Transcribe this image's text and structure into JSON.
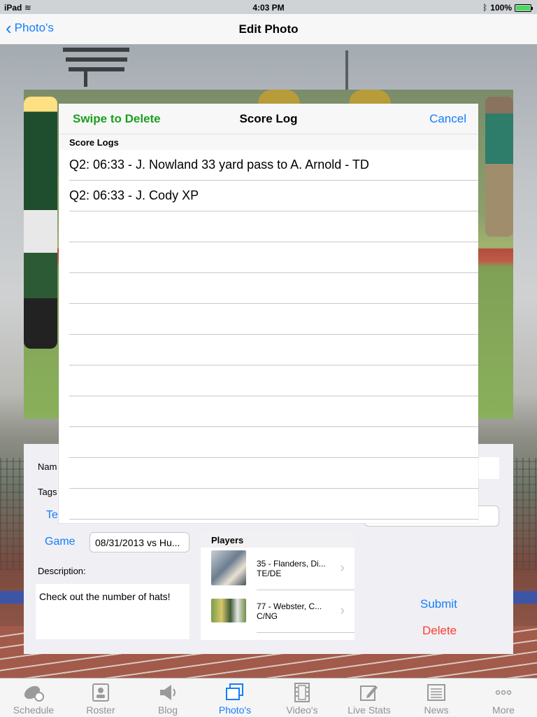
{
  "status": {
    "device": "iPad",
    "time": "4:03 PM",
    "battery": "100%"
  },
  "navbar": {
    "back_label": "Photo's",
    "title": "Edit Photo"
  },
  "form": {
    "name_label": "Nam",
    "tags_label": "Tags",
    "team_label": "Te",
    "game_label": "Game",
    "game_value": "08/31/2013 vs Hu...",
    "description_label": "Description:",
    "description_value": "Check out the number of hats!",
    "players_header": "Players",
    "players": [
      {
        "name": "35 - Flanders, Di...",
        "position": "TE/DE"
      },
      {
        "name": "77 - Webster, C...",
        "position": "C/NG"
      }
    ],
    "submit_label": "Submit",
    "delete_label": "Delete"
  },
  "score_log": {
    "left_action": "Swipe to Delete",
    "title": "Score Log",
    "cancel_label": "Cancel",
    "section_header": "Score Logs",
    "entries": [
      "Q2: 06:33 - J. Nowland 33 yard pass to A. Arnold - TD",
      "Q2: 06:33 - J. Cody XP"
    ]
  },
  "tabbar": {
    "tabs": [
      {
        "label": "Schedule",
        "icon": "football-calendar-icon"
      },
      {
        "label": "Roster",
        "icon": "roster-icon"
      },
      {
        "label": "Blog",
        "icon": "megaphone-icon"
      },
      {
        "label": "Photo's",
        "icon": "photos-icon"
      },
      {
        "label": "Video's",
        "icon": "film-icon"
      },
      {
        "label": "Live Stats",
        "icon": "edit-stats-icon"
      },
      {
        "label": "News",
        "icon": "newspaper-icon"
      },
      {
        "label": "More",
        "icon": "more-icon"
      }
    ],
    "active": "Photo's"
  },
  "colors": {
    "accent": "#147efb",
    "swipe_green": "#1aa01e",
    "delete_red": "#ff3b30"
  }
}
